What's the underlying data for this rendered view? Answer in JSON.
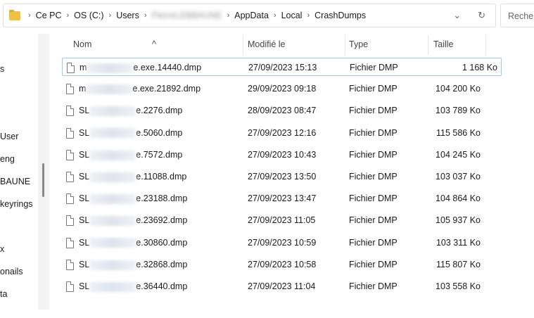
{
  "address": {
    "crumbs": [
      "Ce PC",
      "OS (C:)",
      "Users",
      "PierreLEBBAUNE",
      "AppData",
      "Local",
      "CrashDumps"
    ],
    "search_placeholder": "Rechercher"
  },
  "sidebar": [
    "s",
    "User",
    "eng",
    "BAUNE",
    "keyrings",
    "x",
    "onails",
    "ta"
  ],
  "columns": {
    "name": "Nom",
    "modified": "Modifié le",
    "type": "Type",
    "size": "Taille"
  },
  "files": [
    {
      "prefix": "m",
      "suffix": "e.exe.14440.dmp",
      "modified": "27/09/2023 15:13",
      "type": "Fichier DMP",
      "size": "1 168 Ko"
    },
    {
      "prefix": "m",
      "suffix": "e.exe.21892.dmp",
      "modified": "29/09/2023 09:18",
      "type": "Fichier DMP",
      "size": "104 200 Ko"
    },
    {
      "prefix": "SL",
      "suffix": "e.2276.dmp",
      "modified": "28/09/2023 08:47",
      "type": "Fichier DMP",
      "size": "103 789 Ko"
    },
    {
      "prefix": "SL",
      "suffix": "e.5060.dmp",
      "modified": "27/09/2023 12:16",
      "type": "Fichier DMP",
      "size": "115 586 Ko"
    },
    {
      "prefix": "SL",
      "suffix": "e.7572.dmp",
      "modified": "27/09/2023 10:43",
      "type": "Fichier DMP",
      "size": "104 245 Ko"
    },
    {
      "prefix": "SL",
      "suffix": "e.11088.dmp",
      "modified": "27/09/2023 13:50",
      "type": "Fichier DMP",
      "size": "103 037 Ko"
    },
    {
      "prefix": "SL",
      "suffix": "e.23188.dmp",
      "modified": "27/09/2023 13:47",
      "type": "Fichier DMP",
      "size": "104 864 Ko"
    },
    {
      "prefix": "SL",
      "suffix": "e.23692.dmp",
      "modified": "27/09/2023 11:05",
      "type": "Fichier DMP",
      "size": "105 937 Ko"
    },
    {
      "prefix": "SL",
      "suffix": "e.30860.dmp",
      "modified": "27/09/2023 10:59",
      "type": "Fichier DMP",
      "size": "103 311 Ko"
    },
    {
      "prefix": "SL",
      "suffix": "e.32868.dmp",
      "modified": "27/09/2023 10:58",
      "type": "Fichier DMP",
      "size": "115 807 Ko"
    },
    {
      "prefix": "SL",
      "suffix": "e.36440.dmp",
      "modified": "27/09/2023 11:04",
      "type": "Fichier DMP",
      "size": "103 558 Ko"
    }
  ]
}
